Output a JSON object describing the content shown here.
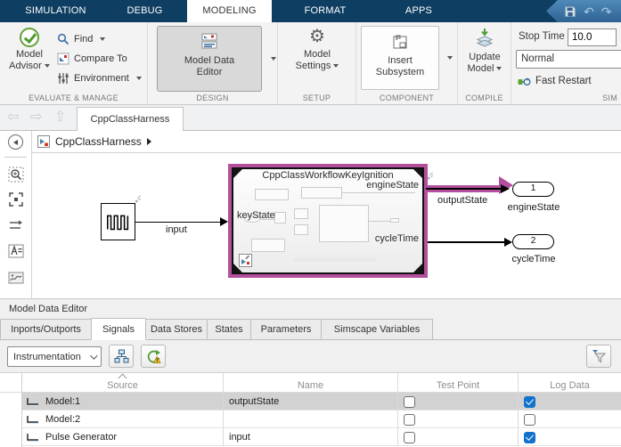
{
  "colors": {
    "toolstrip": "#0e3e62",
    "accent": "#1272cc",
    "selection": "#b3509e"
  },
  "tabs": {
    "items": [
      "SIMULATION",
      "DEBUG",
      "MODELING",
      "FORMAT",
      "APPS"
    ],
    "active": "MODELING"
  },
  "ribbon": {
    "evaluate": {
      "section": "EVALUATE & MANAGE",
      "model_advisor": "Model Advisor",
      "find": "Find",
      "compare_to": "Compare To",
      "environment": "Environment"
    },
    "design": {
      "section": "DESIGN",
      "model_data_editor": "Model Data Editor"
    },
    "setup": {
      "section": "SETUP",
      "model_settings": "Model Settings"
    },
    "component": {
      "section": "COMPONENT",
      "insert_subsystem": "Insert Subsystem"
    },
    "compile": {
      "section": "COMPILE",
      "update_model": "Update Model"
    },
    "simulate": {
      "section": "SIM",
      "stop_time_label": "Stop Time",
      "stop_time_value": "10.0",
      "sim_mode": "Normal",
      "fast_restart": "Fast Restart"
    }
  },
  "docbar": {
    "active_tab": "CppClassHarness"
  },
  "breadcrumb": {
    "model": "CppClassHarness"
  },
  "canvas": {
    "subsystem": {
      "title": "CppClassWorkflowKeyIgnition",
      "port_in": "keyState",
      "port_out1": "engineState",
      "port_out2": "cycleTime"
    },
    "labels": {
      "input_signal": "input",
      "output_signal": "outputState"
    },
    "outport1": {
      "number": "1",
      "label": "engineState"
    },
    "outport2": {
      "number": "2",
      "label": "cycleTime"
    }
  },
  "mde": {
    "title": "Model Data Editor",
    "tabs": [
      "Inports/Outports",
      "Signals",
      "Data Stores",
      "States",
      "Parameters",
      "Simscape Variables"
    ],
    "active_tab": "Signals",
    "toolbar": {
      "filter_value": "Instrumentation"
    },
    "table": {
      "columns": [
        "Source",
        "Name",
        "Test Point",
        "Log Data"
      ],
      "rows": [
        {
          "source": "Model:1",
          "name": "outputState",
          "test_point": false,
          "log_data": true,
          "selected": true
        },
        {
          "source": "Model:2",
          "name": "",
          "test_point": false,
          "log_data": false,
          "selected": false
        },
        {
          "source": "Pulse Generator",
          "name": "input",
          "test_point": false,
          "log_data": true,
          "selected": false
        }
      ]
    }
  }
}
